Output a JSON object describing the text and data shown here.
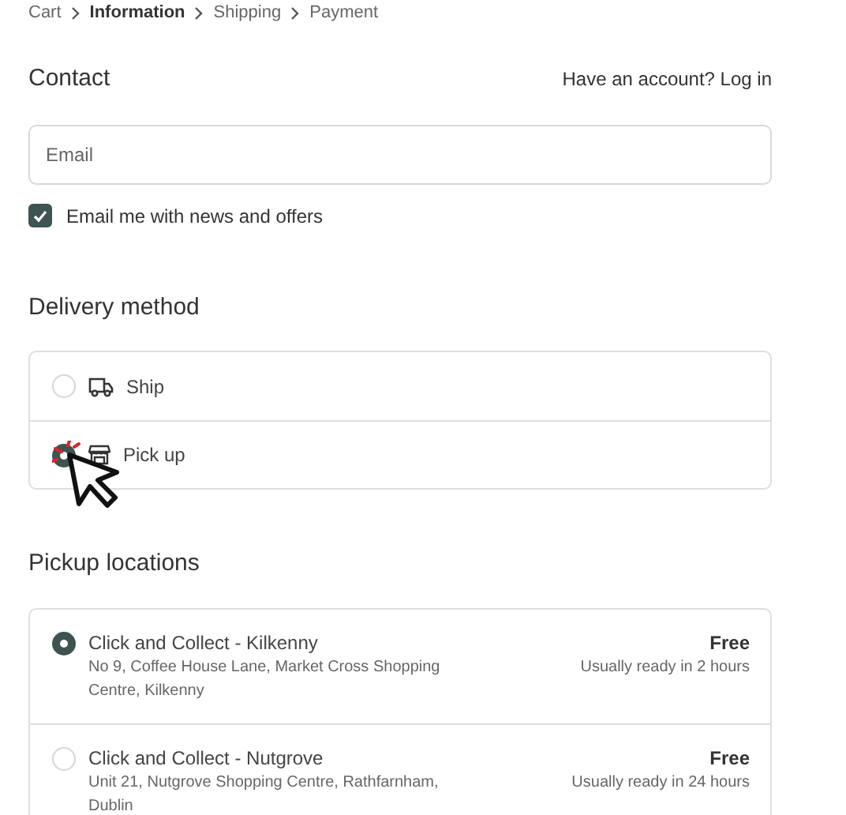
{
  "breadcrumb": [
    {
      "label": "Cart",
      "selected": false
    },
    {
      "label": "Information",
      "selected": true
    },
    {
      "label": "Shipping",
      "selected": false
    },
    {
      "label": "Payment",
      "selected": false
    }
  ],
  "contact": {
    "title": "Contact",
    "login_prompt": "Have an account? Log in",
    "email": {
      "placeholder": "Email"
    },
    "newsletter": {
      "label": "Email me with news and offers",
      "checked": true
    }
  },
  "delivery": {
    "title": "Delivery method",
    "options": [
      {
        "kind": "ship",
        "label": "Ship",
        "selected": false
      },
      {
        "kind": "pickup",
        "label": "Pick up",
        "selected": true
      }
    ]
  },
  "pickup": {
    "title": "Pickup locations",
    "locations": [
      {
        "name": "Click and Collect - Kilkenny",
        "address": "No 9, Coffee House Lane, Market Cross Shopping Centre, Kilkenny",
        "price": "Free",
        "ready": "Usually ready in 2 hours",
        "selected": true
      },
      {
        "name": "Click and Collect - Nutgrove",
        "address": "Unit 21, Nutgrove Shopping Centre, Rathfarnham, Dublin",
        "price": "Free",
        "ready": "Usually ready in 24 hours",
        "selected": false
      }
    ]
  }
}
